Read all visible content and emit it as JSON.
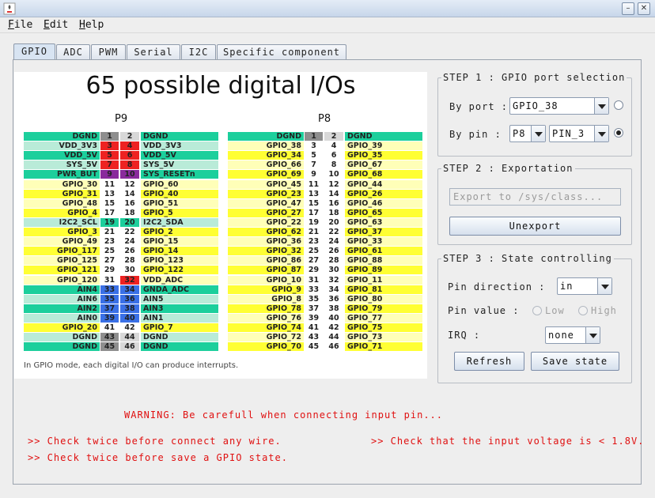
{
  "menubar": {
    "items": [
      {
        "label": "File",
        "mnemonic": "F",
        "rest": "ile"
      },
      {
        "label": "Edit",
        "mnemonic": "E",
        "rest": "dit"
      },
      {
        "label": "Help",
        "mnemonic": "H",
        "rest": "elp"
      }
    ]
  },
  "tabs": [
    "GPIO",
    "ADC",
    "PWM",
    "Serial",
    "I2C",
    "Specific component"
  ],
  "active_tab": "GPIO",
  "pinout": {
    "title": "65 possible digital I/Os",
    "p9_label": "P9",
    "p8_label": "P8",
    "note": "In GPIO mode, each digital I/O can produce interrupts.",
    "colors": {
      "green": "#1ccf9c",
      "lightgreen": "#b9ebd8",
      "yellow": "#ffff33",
      "paleyellow": "#ffffb8",
      "red": "#ee2222",
      "purple": "#8a2a9c",
      "blue": "#3a70e6",
      "gray": "#8e8e8e",
      "lightgray": "#d6d6d6",
      "white": "#ffffff"
    },
    "p9": [
      [
        "DGND",
        "1",
        "2",
        "DGND",
        "green",
        "gray"
      ],
      [
        "VDD_3V3",
        "3",
        "4",
        "VDD_3V3",
        "lightgreen",
        "red"
      ],
      [
        "VDD_5V",
        "5",
        "6",
        "VDD_5V",
        "green",
        "red"
      ],
      [
        "SYS_5V",
        "7",
        "8",
        "SYS_5V",
        "lightgreen",
        "red"
      ],
      [
        "PWR_BUT",
        "9",
        "10",
        "SYS_RESETn",
        "green",
        "purple"
      ],
      [
        "GPIO_30",
        "11",
        "12",
        "GPIO_60",
        "paleyellow",
        "white"
      ],
      [
        "GPIO_31",
        "13",
        "14",
        "GPIO_40",
        "yellow",
        "white"
      ],
      [
        "GPIO_48",
        "15",
        "16",
        "GPIO_51",
        "paleyellow",
        "white"
      ],
      [
        "GPIO_4",
        "17",
        "18",
        "GPIO_5",
        "yellow",
        "white"
      ],
      [
        "I2C2_SCL",
        "19",
        "20",
        "I2C2_SDA",
        "lightgreen",
        "lightgreen"
      ],
      [
        "GPIO_3",
        "21",
        "22",
        "GPIO_2",
        "yellow",
        "white"
      ],
      [
        "GPIO_49",
        "23",
        "24",
        "GPIO_15",
        "paleyellow",
        "white"
      ],
      [
        "GPIO_117",
        "25",
        "26",
        "GPIO_14",
        "yellow",
        "white"
      ],
      [
        "GPIO_125",
        "27",
        "28",
        "GPIO_123",
        "paleyellow",
        "white"
      ],
      [
        "GPIO_121",
        "29",
        "30",
        "GPIO_122",
        "yellow",
        "white"
      ],
      [
        "GPIO_120",
        "31",
        "32",
        "VDD_ADC",
        "paleyellow",
        "red32"
      ],
      [
        "AIN4",
        "33",
        "34",
        "GNDA_ADC",
        "green",
        "blue"
      ],
      [
        "AIN6",
        "35",
        "36",
        "AIN5",
        "lightgreen",
        "blue"
      ],
      [
        "AIN2",
        "37",
        "38",
        "AIN3",
        "green",
        "blue"
      ],
      [
        "AIN0",
        "39",
        "40",
        "AIN1",
        "lightgreen",
        "blue"
      ],
      [
        "GPIO_20",
        "41",
        "42",
        "GPIO_7",
        "yellow",
        "white"
      ],
      [
        "DGND",
        "43",
        "44",
        "DGND",
        "lightgreen",
        "gray"
      ],
      [
        "DGND",
        "45",
        "46",
        "DGND",
        "green",
        "gray"
      ]
    ],
    "p8": [
      [
        "DGND",
        "1",
        "2",
        "DGND",
        "green",
        "gray"
      ],
      [
        "GPIO_38",
        "3",
        "4",
        "GPIO_39",
        "paleyellow",
        "white"
      ],
      [
        "GPIO_34",
        "5",
        "6",
        "GPIO_35",
        "yellow",
        "white"
      ],
      [
        "GPIO_66",
        "7",
        "8",
        "GPIO_67",
        "paleyellow",
        "white"
      ],
      [
        "GPIO_69",
        "9",
        "10",
        "GPIO_68",
        "yellow",
        "white"
      ],
      [
        "GPIO_45",
        "11",
        "12",
        "GPIO_44",
        "paleyellow",
        "white"
      ],
      [
        "GPIO_23",
        "13",
        "14",
        "GPIO_26",
        "yellow",
        "white"
      ],
      [
        "GPIO_47",
        "15",
        "16",
        "GPIO_46",
        "paleyellow",
        "white"
      ],
      [
        "GPIO_27",
        "17",
        "18",
        "GPIO_65",
        "yellow",
        "white"
      ],
      [
        "GPIO_22",
        "19",
        "20",
        "GPIO_63",
        "paleyellow",
        "white"
      ],
      [
        "GPIO_62",
        "21",
        "22",
        "GPIO_37",
        "yellow",
        "white"
      ],
      [
        "GPIO_36",
        "23",
        "24",
        "GPIO_33",
        "paleyellow",
        "white"
      ],
      [
        "GPIO_32",
        "25",
        "26",
        "GPIO_61",
        "yellow",
        "white"
      ],
      [
        "GPIO_86",
        "27",
        "28",
        "GPIO_88",
        "paleyellow",
        "white"
      ],
      [
        "GPIO_87",
        "29",
        "30",
        "GPIO_89",
        "yellow",
        "white"
      ],
      [
        "GPIO_10",
        "31",
        "32",
        "GPIO_11",
        "paleyellow",
        "white"
      ],
      [
        "GPIO_9",
        "33",
        "34",
        "GPIO_81",
        "yellow",
        "white"
      ],
      [
        "GPIO_8",
        "35",
        "36",
        "GPIO_80",
        "paleyellow",
        "white"
      ],
      [
        "GPIO_78",
        "37",
        "38",
        "GPIO_79",
        "yellow",
        "white"
      ],
      [
        "GPIO_76",
        "39",
        "40",
        "GPIO_77",
        "paleyellow",
        "white"
      ],
      [
        "GPIO_74",
        "41",
        "42",
        "GPIO_75",
        "yellow",
        "white"
      ],
      [
        "GPIO_72",
        "43",
        "44",
        "GPIO_73",
        "paleyellow",
        "white"
      ],
      [
        "GPIO_70",
        "45",
        "46",
        "GPIO_71",
        "yellow",
        "white"
      ]
    ]
  },
  "step1": {
    "title": "STEP 1 : GPIO port selection",
    "by_port_label": "By port :",
    "port_value": "GPIO_38",
    "by_pin_label": "By pin :",
    "header_value": "P8",
    "pin_value": "PIN_3",
    "selected_mode": "by_pin"
  },
  "step2": {
    "title": "STEP 2 : Exportation",
    "export_placeholder": "Export to /sys/class...",
    "unexport_label": "Unexport"
  },
  "step3": {
    "title": "STEP 3 : State controlling",
    "direction_label": "Pin direction :",
    "direction_value": "in",
    "value_label": "Pin value :",
    "low_label": "Low",
    "high_label": "High",
    "irq_label": "IRQ :",
    "irq_value": "none",
    "refresh_label": "Refresh",
    "save_label": "Save state"
  },
  "warnings": {
    "title": "WARNING: Be carefull when connecting input pin...",
    "check1": ">> Check twice before connect any wire.",
    "check2": ">> Check that the input voltage is < 1.8V.",
    "check3": ">> Check twice before save a GPIO state."
  }
}
